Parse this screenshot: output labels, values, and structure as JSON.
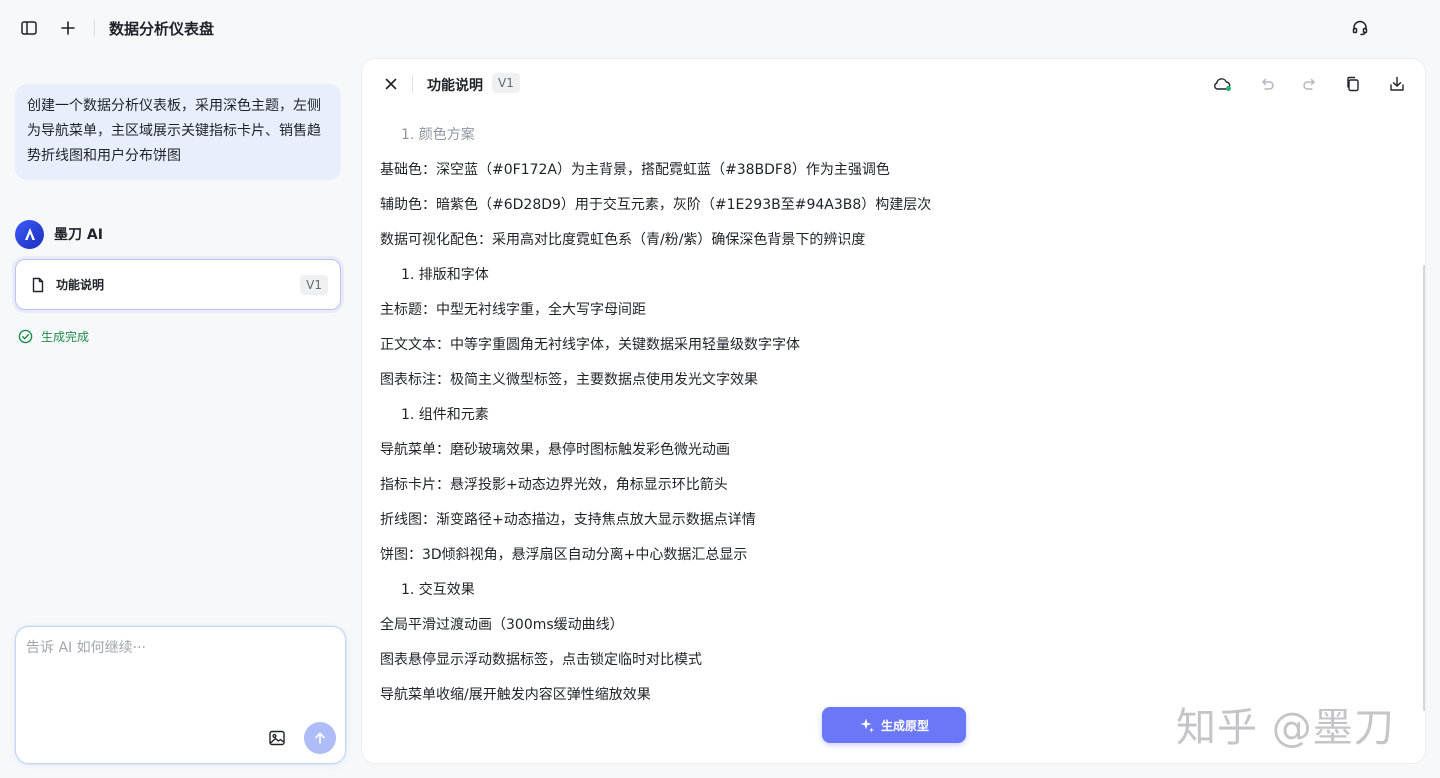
{
  "topbar": {
    "title": "数据分析仪表盘"
  },
  "chat": {
    "user_prompt": "创建一个数据分析仪表板，采用深色主题，左侧为导航菜单，主区域展示关键指标卡片、销售趋势折线图和用户分布饼图",
    "ai_name": "墨刀 AI",
    "doc_card": {
      "label": "功能说明",
      "version": "V1"
    },
    "status": "生成完成",
    "input_placeholder": "告诉 AI 如何继续···"
  },
  "doc": {
    "title": "功能说明",
    "version": "V1",
    "lines": [
      {
        "text": "1. 颜色方案",
        "type": "num",
        "faded": true
      },
      {
        "text": "基础色：深空蓝（#0F172A）为主背景，搭配霓虹蓝（#38BDF8）作为主强调色",
        "type": "body"
      },
      {
        "text": "辅助色：暗紫色（#6D28D9）用于交互元素，灰阶（#1E293B至#94A3B8）构建层次",
        "type": "body"
      },
      {
        "text": "数据可视化配色：采用高对比度霓虹色系（青/粉/紫）确保深色背景下的辨识度",
        "type": "body"
      },
      {
        "text": "1. 排版和字体",
        "type": "num"
      },
      {
        "text": "主标题：中型无衬线字重，全大写字母间距",
        "type": "body"
      },
      {
        "text": "正文文本：中等字重圆角无衬线字体，关键数据采用轻量级数字字体",
        "type": "body"
      },
      {
        "text": "图表标注：极简主义微型标签，主要数据点使用发光文字效果",
        "type": "body"
      },
      {
        "text": "1. 组件和元素",
        "type": "num"
      },
      {
        "text": "导航菜单：磨砂玻璃效果，悬停时图标触发彩色微光动画",
        "type": "body"
      },
      {
        "text": "指标卡片：悬浮投影+动态边界光效，角标显示环比箭头",
        "type": "body"
      },
      {
        "text": "折线图：渐变路径+动态描边，支持焦点放大显示数据点详情",
        "type": "body"
      },
      {
        "text": "饼图：3D倾斜视角，悬浮扇区自动分离+中心数据汇总显示",
        "type": "body"
      },
      {
        "text": "1. 交互效果",
        "type": "num"
      },
      {
        "text": "全局平滑过渡动画（300ms缓动曲线）",
        "type": "body"
      },
      {
        "text": "图表悬停显示浮动数据标签，点击锁定临时对比模式",
        "type": "body"
      },
      {
        "text": "导航菜单收缩/展开触发内容区弹性缩放效果",
        "type": "body"
      }
    ],
    "generate_label": "生成原型"
  },
  "watermark": "知乎 @墨刀",
  "colors": {
    "accent": "#6a77f6",
    "prompt_bg": "#e8eefc",
    "success": "#1f8a4c"
  },
  "icons": [
    "sidebar-toggle-icon",
    "plus-icon",
    "headset-icon",
    "close-icon",
    "cloud-icon",
    "undo-icon",
    "redo-icon",
    "copy-icon",
    "download-icon",
    "file-icon",
    "check-circle-icon",
    "image-icon",
    "arrow-up-icon",
    "sparkle-icon"
  ]
}
